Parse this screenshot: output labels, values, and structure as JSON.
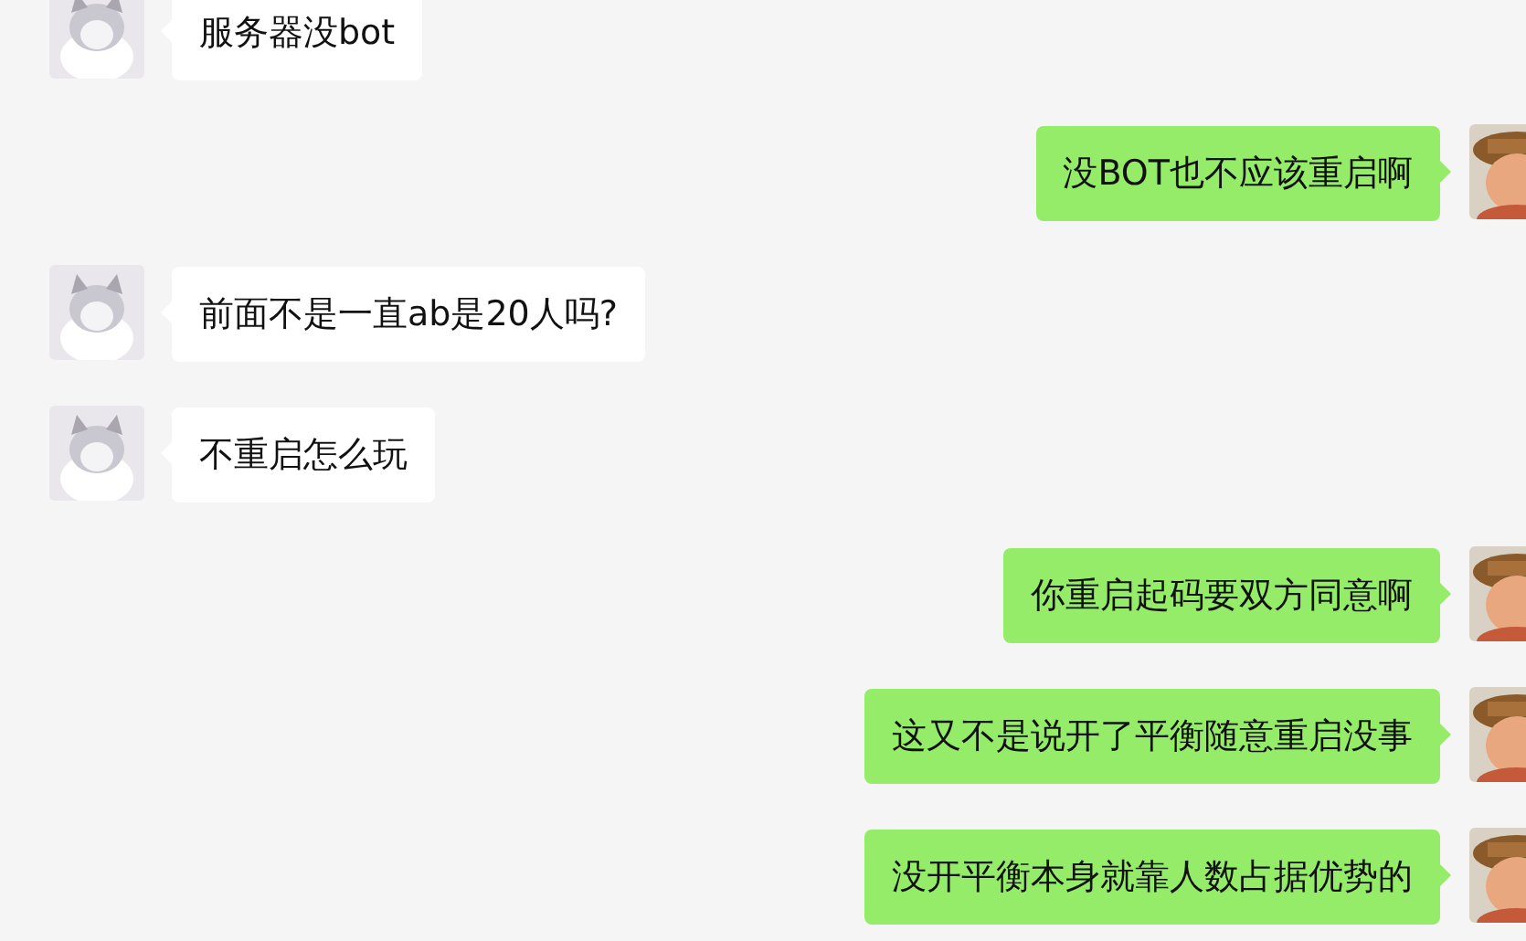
{
  "messages": [
    {
      "kind": "received",
      "text": "服务器没bot"
    },
    {
      "kind": "sent",
      "text": "没BOT也不应该重启啊"
    },
    {
      "kind": "received",
      "text": "前面不是一直ab是20人吗?"
    },
    {
      "kind": "received",
      "text": "不重启怎么玩"
    },
    {
      "kind": "sent",
      "text": "你重启起码要双方同意啊"
    },
    {
      "kind": "sent",
      "text": "这又不是说开了平衡随意重启没事"
    },
    {
      "kind": "sent",
      "text": "没开平衡本身就靠人数占据优势的"
    }
  ]
}
